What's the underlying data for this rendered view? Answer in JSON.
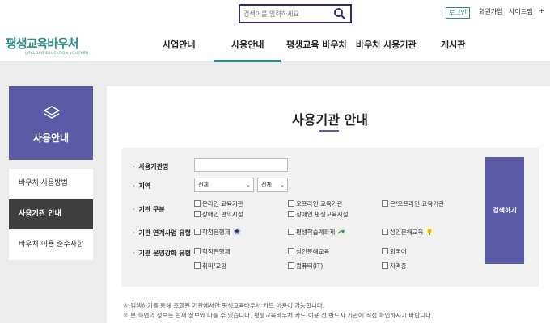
{
  "top": {
    "search_placeholder": "검색어를 입력하세요",
    "login": "로그인",
    "signup": "회원가입",
    "sitemap": "사이트맵",
    "plus": "+"
  },
  "logo": {
    "text": "평생교육바우처",
    "subtext": "LIFELONG EDUCATION VOUCHER"
  },
  "nav": [
    "사업안내",
    "사용안내",
    "평생교육 바우처",
    "바우처 사용기관",
    "게시판"
  ],
  "nav_active_index": 1,
  "sidebar": {
    "title": "사용안내",
    "items": [
      "바우처 사용방법",
      "사용기관 안내",
      "바우처 이용 준수사항"
    ],
    "active_index": 1
  },
  "main": {
    "title": "사용기관 안내",
    "form": {
      "labels": {
        "name": "사용기관명",
        "region": "지역",
        "type": "기관 구분",
        "link": "기관 연계사업 유형",
        "strength": "기관 운영강화 유형"
      },
      "name_value": "",
      "region_select_1": "전체",
      "region_select_2": "전체",
      "type_options": [
        "온라인 교육기관",
        "오프라인 교육기관",
        "온/오프라인 교육기관",
        "장애인 편의시설",
        "장애인 평생교육시설"
      ],
      "link_options": [
        "학점은행제",
        "평생학습계좌제",
        "성인문해교육"
      ],
      "strength_options": [
        "학점은행제",
        "성인문해교육",
        "외국어",
        "취미/교양",
        "컴퓨터(IT)",
        "자격증"
      ],
      "search_button": "검색하기"
    },
    "notes": [
      "검색하기를 통해 조회된 기관에서만 평생교육바우처 카드 이용이 가능합니다.",
      "본 화면의 정보는 현재 정보와 다를 수 있습니다. 평생교육바우처 카드 이용 전 반드시 기관에 직접 확인하시기 바랍니다."
    ],
    "note_mark": "※"
  },
  "colors": {
    "accent": "#5a5aa6",
    "brand": "#2f8a86",
    "search_border": "#2b2f6b"
  }
}
